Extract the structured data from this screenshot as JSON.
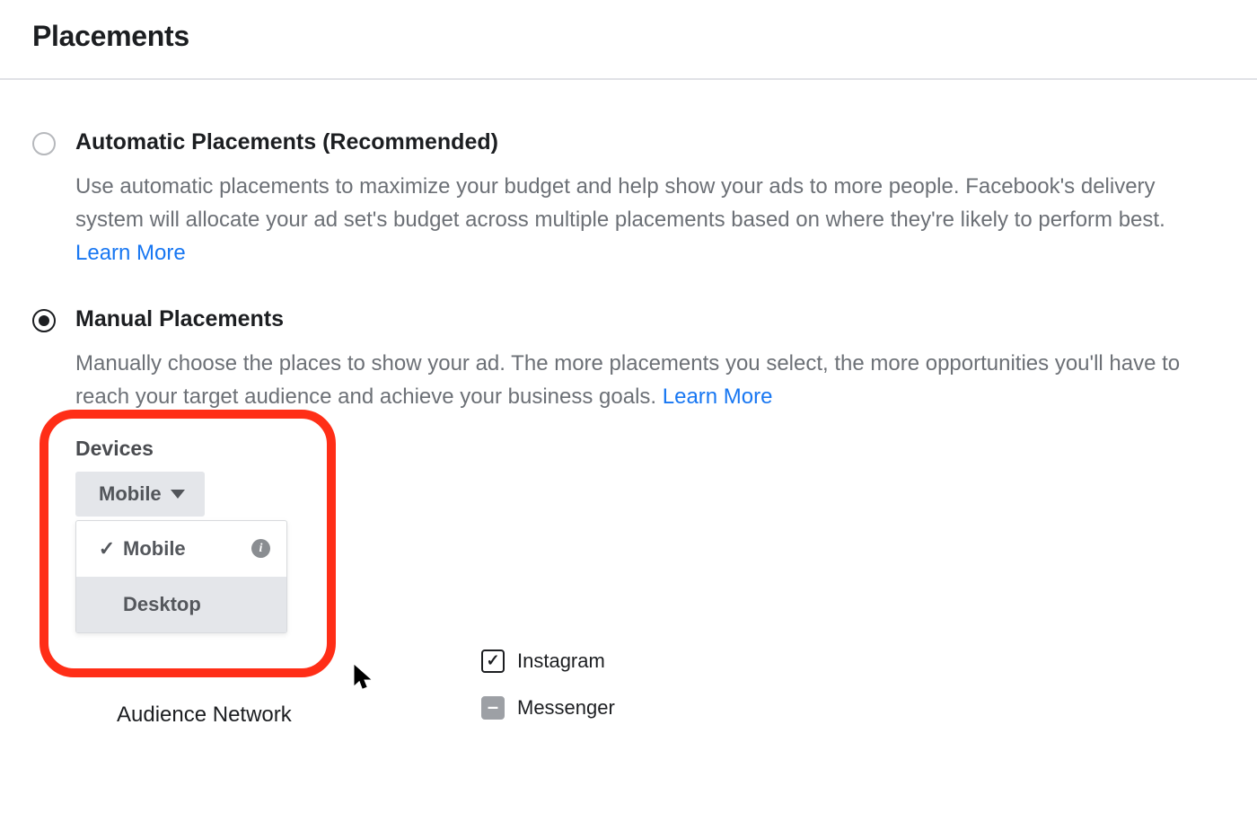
{
  "section_title": "Placements",
  "options": {
    "automatic": {
      "title": "Automatic Placements (Recommended)",
      "desc_pre": "Use automatic placements to maximize your budget and help show your ads to more people. Facebook's delivery system will allocate your ad set's budget across multiple placements based on where they're likely to perform best. ",
      "learn_more": "Learn More"
    },
    "manual": {
      "title": "Manual Placements",
      "desc_pre": "Manually choose the places to show your ad. The more placements you select, the more opportunities you'll have to reach your target audience and achieve your business goals. ",
      "learn_more": "Learn More"
    }
  },
  "devices": {
    "label": "Devices",
    "selected": "Mobile",
    "menu": {
      "mobile": "Mobile",
      "desktop": "Desktop"
    }
  },
  "platforms": {
    "audience_network": "Audience Network",
    "instagram": "Instagram",
    "messenger": "Messenger"
  },
  "glyphs": {
    "check": "✓",
    "dash": "–",
    "cursor": "➤",
    "info": "i"
  }
}
